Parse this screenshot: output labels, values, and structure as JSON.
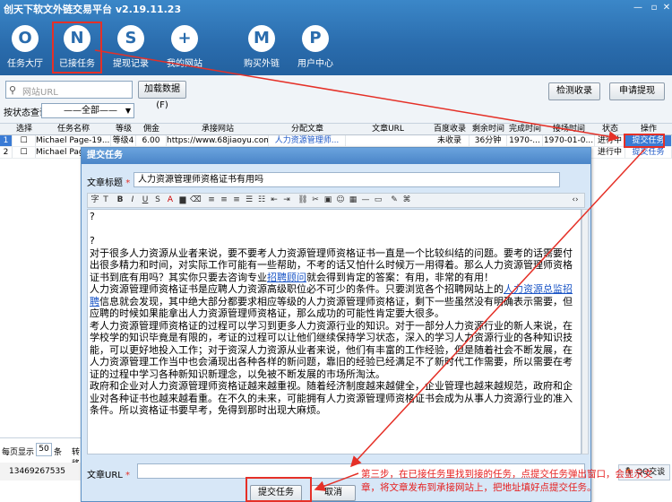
{
  "app": {
    "title": "创天下软文外链交易平台 v2.19.11.23"
  },
  "nav": [
    {
      "icon": "O",
      "label": "任务大厅",
      "icon_name": "task-hall-icon"
    },
    {
      "icon": "N",
      "label": "已接任务",
      "icon_name": "accepted-tasks-icon"
    },
    {
      "icon": "S",
      "label": "提现记录",
      "icon_name": "withdraw-record-icon"
    },
    {
      "icon": "+",
      "label": "我的网站",
      "icon_name": "my-site-icon"
    },
    {
      "icon": "M",
      "label": "购买外链",
      "icon_name": "buy-link-icon"
    },
    {
      "icon": "P",
      "label": "用户中心",
      "icon_name": "user-center-icon"
    }
  ],
  "toolbar": {
    "search_placeholder": "网站URL",
    "load_button": "加载数据(F)",
    "check_index": "检测收录",
    "apply_withdraw": "申请提现",
    "filter_label": "按状态查询",
    "filter_value": "——全部——"
  },
  "table": {
    "headers": [
      "",
      "选择",
      "任务名称",
      "等级",
      "佣金",
      "承接网站",
      "分配文章",
      "文章URL",
      "百度收录",
      "剩余时间",
      "完成时间",
      "接场时间",
      "状态",
      "操作"
    ],
    "rows": [
      [
        "1",
        "",
        "Michael Page-19...",
        "等级4",
        "6.00",
        "https://www.68jiaoyu.com",
        "人力资源管理师...",
        "",
        "未收录",
        "36分钟",
        "1970-...",
        "1970-01-0...",
        "进行中",
        "提交任务"
      ],
      [
        "2",
        "",
        "Michael Page-19...",
        "",
        "",
        "",
        "",
        "",
        "",
        "",
        "",
        "",
        "进行中",
        "提交任务"
      ]
    ]
  },
  "dialog": {
    "title": "提交任务",
    "title_label": "文章标题",
    "title_value": "人力资源管理师资格证书有用吗",
    "editor_lines": [
      "?",
      "",
      "?",
      "对于很多人力资源从业者来说，要不要考人力资源管理师资格证书一直是一个比较纠结的问题。要考的话需要付出很多精力和时间，对实际工作可能有一些帮助，不考的话又怕什么时候万一用得着。那么人力资源管理师资格证书到底有用吗？其实你只要去咨询专业",
      {
        "link": "招聘顾问"
      },
      "就会得到肯定的答案：有用，非常的有用！"
    ],
    "p1": "?",
    "p2": "?",
    "p3a": "对于很多人力资源从业者来说，要不要考人力资源管理师资格证书一直是一个比较纠结的问题。要考的话需要付出很多精力和时间，对实际工作可能有一些帮助，不考的话又怕什么时候万一用得着。那么人力资源管理师资格证书到底有用吗？其实你只要去咨询专业",
    "p3link": "招聘顾问",
    "p3b": "就会得到肯定的答案：有用，非常的有用！",
    "p4a": "人力资源管理师资格证书是应聘人力资源高级职位必不可少的条件。只要浏览各个招聘网站上的",
    "p4link": "人力资源总监招聘",
    "p4b": "信息就会发现，其中绝大部分都要求相应等级的人力资源管理师资格证，剩下一些虽然没有明确表示需要，但应聘的时候如果能拿出人力资源管理师资格证，那么成功的可能性肯定要大很多。",
    "p5": "考人力资源管理师资格证的过程可以学习到更多人力资源行业的知识。对于一部分人力资源行业的新人来说，在学校学的知识毕竟是有限的，考证的过程可以让他们继续保持学习状态，深入的学习人力资源行业的各种知识技能，可以更好地投入工作；对于资深人力资源从业者来说，他们有丰富的工作经验，但是随着社会不断发展，在人力资源管理工作当中也会涌现出各种各样的新问题，靠旧的经验已经满足不了新时代工作需要，所以需要在考证的过程中学习各种新知识新理念，以免被不断发展的市场所淘汰。",
    "p6": "政府和企业对人力资源管理师资格证越来越重视。随着经济制度越来越健全，企业管理也越来越规范，政府和企业对各种证书也越来越看重。在不久的未来，可能拥有人力资源管理师资格证书会成为从事人力资源行业的准入条件。所以资格证书要早考，免得到那时出现大麻烦。",
    "url_label": "文章URL",
    "url_value": "",
    "submit": "提交任务",
    "cancel": "取消"
  },
  "bottom": {
    "page_label": "每页显示",
    "page_size": "50",
    "page_unit": "条",
    "trans_label": "转移",
    "phone": "13469267535",
    "qq": "QQ交谈"
  },
  "annotation": "第三步，在已接任务里找到接的任务，点提交任务弹出窗口，会显示文章，将文章发布到承接网站上，把地址填好点提交任务。",
  "colors": {
    "top_bar": "#2a6cad",
    "highlight": "#e53027",
    "annotation": "#e61e1e",
    "link": "#1a55c6"
  }
}
